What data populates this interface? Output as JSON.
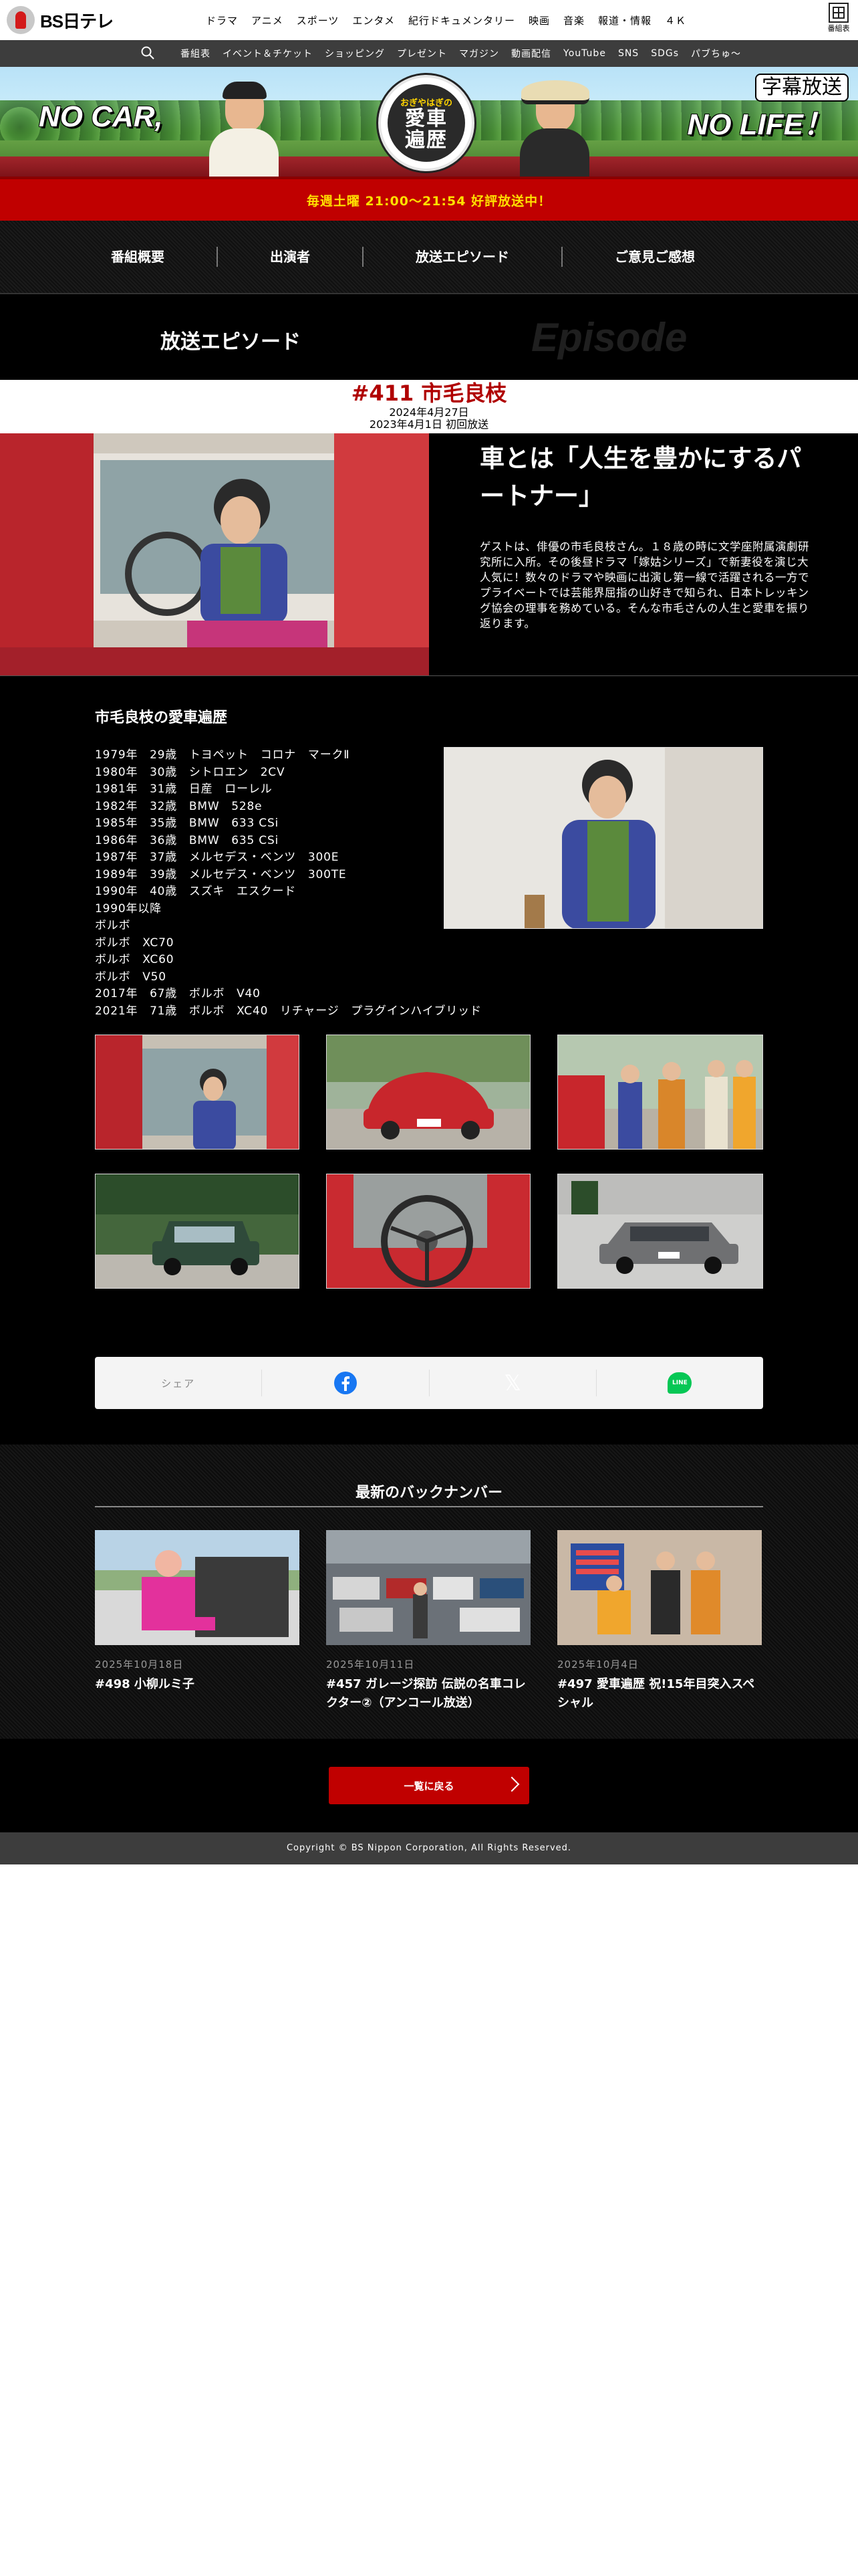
{
  "header": {
    "logo_text": "BS日テレ",
    "nav": [
      "ドラマ",
      "アニメ",
      "スポーツ",
      "エンタメ",
      "紀行ドキュメンタリー",
      "映画",
      "音楽",
      "報道・情報",
      "４Ｋ"
    ],
    "program_guide_label": "番組表"
  },
  "subnav": {
    "items": [
      "番組表",
      "イベント＆チケット",
      "ショッピング",
      "プレゼント",
      "マガジン",
      "動画配信",
      "YouTube",
      "SNS",
      "SDGs",
      "パブちゅ〜"
    ]
  },
  "hero": {
    "left_slogan": "NO CAR,",
    "right_slogan": "NO LIFE！",
    "badge_small": "おぎやはぎの",
    "badge_line1": "愛車",
    "badge_line2": "遍歴",
    "subtitle_badge": "字幕放送"
  },
  "onair": {
    "text": "毎週土曜 21:00〜21:54 好評放送中！"
  },
  "program_nav": [
    "番組概要",
    "出演者",
    "放送エピソード",
    "ご意見ご感想"
  ],
  "section": {
    "title_jp": "放送エピソード",
    "title_en": "Episode"
  },
  "episode": {
    "number_title": "#411 市毛良枝",
    "date": "2024年4月27日",
    "first_air": "2023年4月1日 初回放送"
  },
  "feature": {
    "headline": "車とは「人生を豊かにするパートナー」",
    "body": "ゲストは、俳優の市毛良枝さん。１８歳の時に文学座附属演劇研究所に入所。その後昼ドラマ「嫁姑シリーズ」で新妻役を演じ大人気に！数々のドラマや映画に出演し第一線で活躍される一方でプライベートでは芸能界屈指の山好きで知られ、日本トレッキング協会の理事を務めている。そんな市毛さんの人生と愛車を振り返ります。"
  },
  "car_history": {
    "title": "市毛良枝の愛車遍歴",
    "items": [
      "1979年　29歳　トヨペット　コロナ　マークⅡ",
      "1980年　30歳　シトロエン　2CV",
      "1981年　31歳　日産　ローレル",
      "1982年　32歳　BMW　528e",
      "1985年　35歳　BMW　633 CSi",
      "1986年　36歳　BMW　635 CSi",
      "1987年　37歳　メルセデス・ベンツ　300E",
      "1989年　39歳　メルセデス・ベンツ　300TE",
      "1990年　40歳　スズキ　エスクード",
      "1990年以降",
      "ボルボ",
      "ボルボ　XC70",
      "ボルボ　XC60",
      "ボルボ　V50",
      "2017年　67歳　ボルボ　V40",
      "2021年　71歳　ボルボ　XC40　リチャージ　プラグインハイブリッド"
    ]
  },
  "share": {
    "label": "シェア",
    "x_glyph": "𝕏",
    "line_label": "LINE"
  },
  "backnumbers": {
    "title": "最新のバックナンバー",
    "items": [
      {
        "date": "2025年10月18日",
        "title": "#498 小柳ルミ子"
      },
      {
        "date": "2025年10月11日",
        "title": "#457 ガレージ探訪 伝説の名車コレクター②（アンコール放送）"
      },
      {
        "date": "2025年10月4日",
        "title": "#497 愛車遍歴 祝!15年目突入スペシャル"
      }
    ]
  },
  "back_button": {
    "label": "一覧に戻る"
  },
  "footer": {
    "copyright": "Copyright © BS Nippon Corporation, All Rights Reserved."
  },
  "colors": {
    "brand_red": "#c00000",
    "onair_yellow": "#ffe000",
    "episode_red": "#b00000"
  }
}
